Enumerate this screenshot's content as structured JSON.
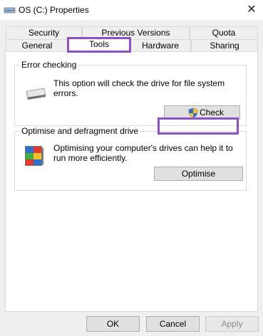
{
  "window": {
    "title": "OS (C:) Properties",
    "close_glyph": "✕"
  },
  "tabs": {
    "back_row": [
      "Security",
      "Previous Versions",
      "Quota"
    ],
    "front_row": [
      "General",
      "Tools",
      "Hardware",
      "Sharing"
    ],
    "selected": "Tools"
  },
  "error_checking": {
    "group_title": "Error checking",
    "description": "This option will check the drive for file system errors.",
    "button_label": "Check",
    "icon": "drive-icon"
  },
  "optimise": {
    "group_title": "Optimise and defragment drive",
    "description": "Optimising your computer's drives can help it to run more efficiently.",
    "button_label": "Optimise",
    "icon": "defrag-icon"
  },
  "footer": {
    "ok_label": "OK",
    "cancel_label": "Cancel",
    "apply_label": "Apply"
  },
  "colors": {
    "highlight": "#8e4fc0",
    "dialog_bg": "#f0f0f0"
  }
}
